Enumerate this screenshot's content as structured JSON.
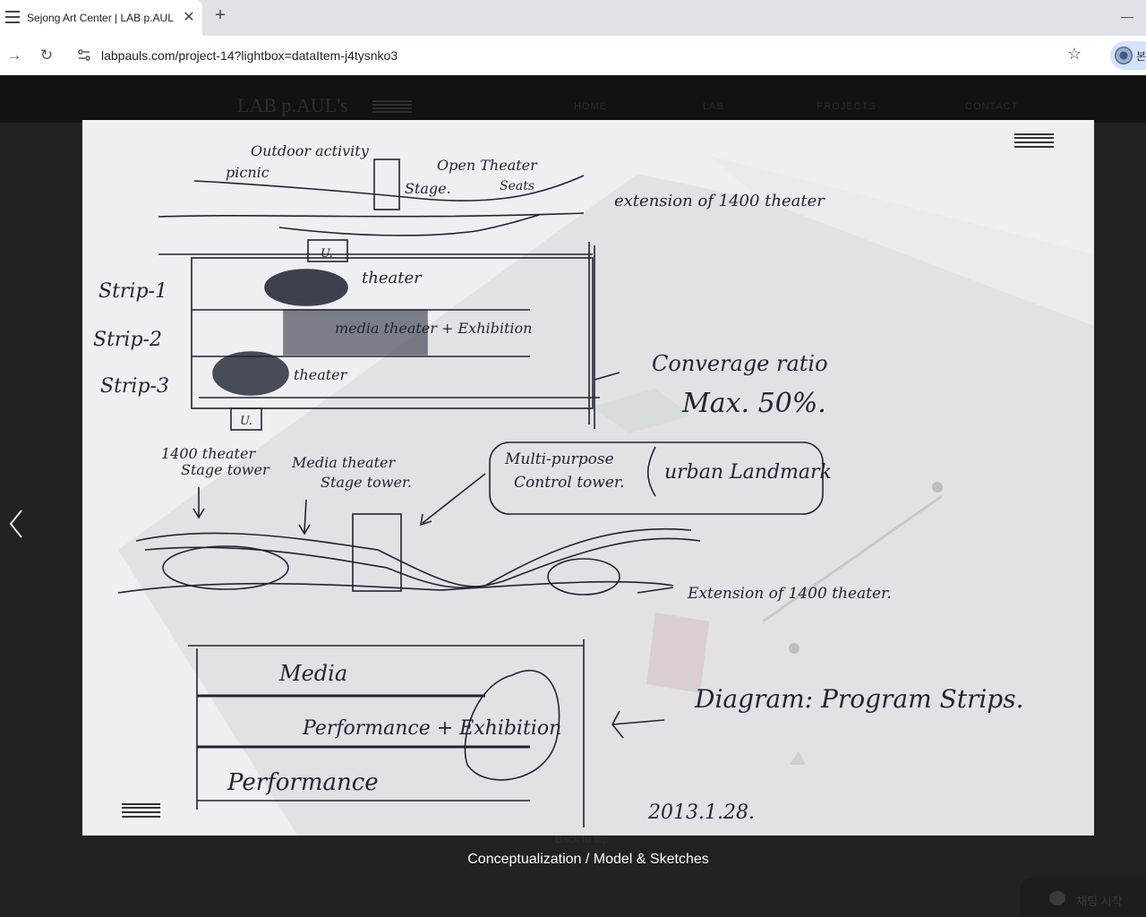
{
  "browser": {
    "tab_title": "Sejong Art Center | LAB p.AUL'",
    "close_glyph": "✕",
    "new_tab_glyph": "+",
    "url": "labpauls.com/project-14?lightbox=dataItem-j4tysnko3",
    "back_glyph": "←",
    "forward_glyph": "→",
    "reload_glyph": "↻",
    "star_glyph": "☆",
    "profile_text": "본"
  },
  "site": {
    "logo": "LAB p.AUL's",
    "nav": [
      "HOME",
      "LAB",
      "PROJECTS",
      "CONTACT"
    ],
    "back_to_top": "Back to top",
    "chat_label": "채팅 시작"
  },
  "lightbox": {
    "caption": "Conceptualization / Model & Sketches",
    "prev_glyph": "‹"
  },
  "sketch": {
    "notes": {
      "outdoor": "Outdoor activity",
      "picnic": "picnic",
      "open_theater": "Open Theater",
      "stage": "Stage.",
      "seats": "Seats",
      "extension_top": "extension of 1400 theater",
      "strip1": "Strip-1",
      "strip2": "Strip-2",
      "strip3": "Strip-3",
      "u_top": "U.",
      "u_bottom": "U.",
      "theater": "theater",
      "media_exhibition": "media theater + Exhibition",
      "theater3": "theater",
      "coverage": "Converage ratio",
      "max": "Max. 50%.",
      "t1400_stage": "1400 theater",
      "stage_tower": "Stage tower",
      "media_theater": "Media theater",
      "stage_tower2": "Stage tower.",
      "multi_purpose": "Multi-purpose",
      "control_tower": "Control tower.",
      "urban_landmark": "urban Landmark",
      "extension_mid": "Extension of 1400 theater.",
      "media": "Media",
      "performance_exhibition": "Performance + Exhibition",
      "performance": "Performance",
      "diagram": "Diagram: Program Strips.",
      "date": "2013.1.28."
    }
  }
}
